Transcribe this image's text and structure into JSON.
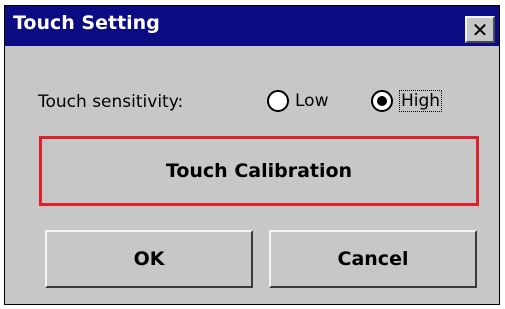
{
  "dialog": {
    "title": "Touch Setting",
    "close_glyph": "✕"
  },
  "sensitivity": {
    "label": "Touch sensitivity:",
    "options": [
      {
        "label": "Low",
        "selected": false
      },
      {
        "label": "High",
        "selected": true
      }
    ]
  },
  "buttons": {
    "calibration": "Touch Calibration",
    "ok": "OK",
    "cancel": "Cancel"
  },
  "colors": {
    "titlebar": "#0b0b84",
    "dialog_bg": "#c7c7c7",
    "highlight_border": "#e0202a"
  }
}
